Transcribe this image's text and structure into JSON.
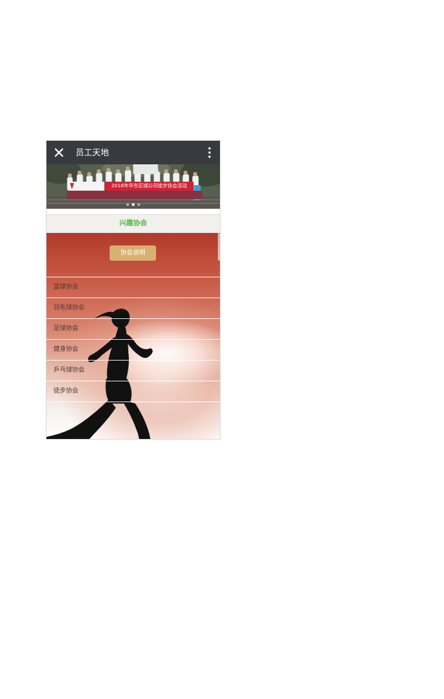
{
  "topbar": {
    "title": "员工天地",
    "close_icon": "close-icon",
    "more_icon": "more-vertical-icon"
  },
  "banner": {
    "caption": "2016年华东区城公司徒步协会活动",
    "dots": 3,
    "active_dot": 2
  },
  "section": {
    "title": "兴趣协会"
  },
  "content": {
    "description_button": "协会说明",
    "associations": [
      {
        "label": "篮球协会"
      },
      {
        "label": "羽毛球协会"
      },
      {
        "label": "足球协会"
      },
      {
        "label": "健身协会"
      },
      {
        "label": "乒乓球协会"
      },
      {
        "label": "徒步协会"
      }
    ]
  },
  "colors": {
    "topbar_bg": "#393a3f",
    "section_title": "#5bb84f",
    "button_bg": "#d9b070",
    "banner_caption_bg": "#d12236"
  }
}
